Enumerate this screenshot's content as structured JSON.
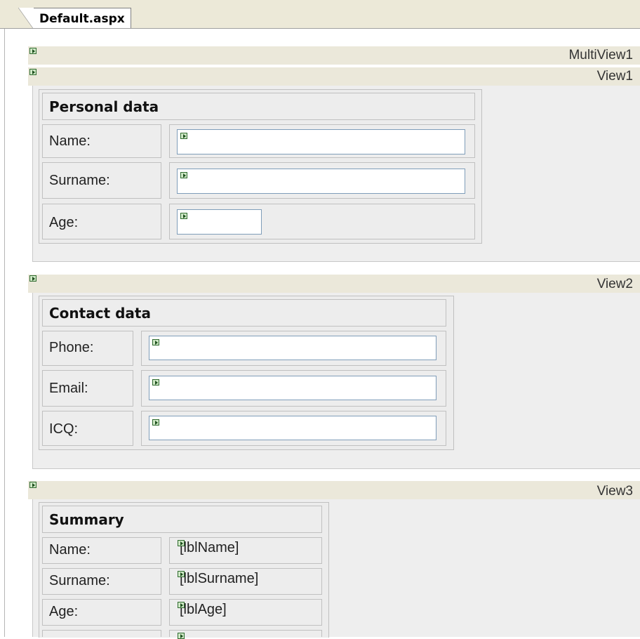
{
  "tab": {
    "label": "Default.aspx"
  },
  "multiview": {
    "label": "MultiView1"
  },
  "views": [
    {
      "name": "View1",
      "header": "Personal data",
      "rows": [
        {
          "label": "Name:"
        },
        {
          "label": "Surname:"
        },
        {
          "label": "Age:"
        }
      ]
    },
    {
      "name": "View2",
      "header": "Contact data",
      "rows": [
        {
          "label": "Phone:"
        },
        {
          "label": "Email:"
        },
        {
          "label": "ICQ:"
        }
      ]
    },
    {
      "name": "View3",
      "header": "Summary",
      "rows": [
        {
          "label": "Name:",
          "value": "[lblName]"
        },
        {
          "label": "Surname:",
          "value": "[lblSurname]"
        },
        {
          "label": "Age:",
          "value": "[lblAge]"
        }
      ]
    }
  ],
  "icons": {
    "control": "aspnet-control-glyph-icon"
  },
  "colors": {
    "band": "#ebe8da",
    "view_bg": "#eeeeee",
    "textbox_border": "#7f9db9"
  }
}
